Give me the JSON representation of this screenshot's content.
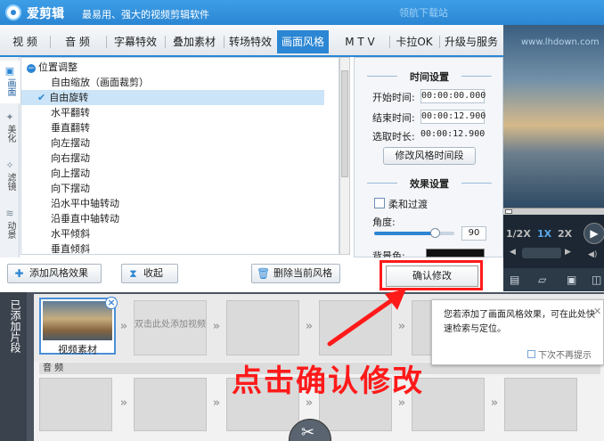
{
  "app": {
    "title": "爱剪辑",
    "slogan": "最易用、强大的视频剪辑软件",
    "watermark": "领航下载站"
  },
  "tabs": [
    {
      "label": "视 频",
      "active": false
    },
    {
      "label": "音 频",
      "active": false
    },
    {
      "label": "字幕特效",
      "active": false
    },
    {
      "label": "叠加素材",
      "active": false
    },
    {
      "label": "转场特效",
      "active": false
    },
    {
      "label": "画面风格",
      "active": true
    },
    {
      "label": "M T V",
      "active": false
    },
    {
      "label": "卡拉OK",
      "active": false
    },
    {
      "label": "升级与服务",
      "active": false
    }
  ],
  "leftbar": [
    {
      "label": "画面",
      "icon": "screen-icon",
      "active": true
    },
    {
      "label": "美化",
      "icon": "magic-wand-icon",
      "active": false
    },
    {
      "label": "滤镜",
      "icon": "filter-wand-icon",
      "active": false
    },
    {
      "label": "动景",
      "icon": "wave-icon",
      "active": false
    }
  ],
  "list": {
    "group": "位置调整",
    "items": [
      "自由缩放（画面裁剪）",
      "自由旋转",
      "水平翻转",
      "垂直翻转",
      "向左摆动",
      "向右摆动",
      "向上摆动",
      "向下摆动",
      "沿水平中轴转动",
      "沿垂直中轴转动",
      "水平倾斜",
      "垂直倾斜"
    ],
    "selected_index": 1
  },
  "settings": {
    "time_title": "时间设置",
    "start_label": "开始时间:",
    "start_value": "00:00:00.000",
    "end_label": "结束时间:",
    "end_value": "00:00:12.900",
    "duration_label": "选取时长:",
    "duration_value": "00:00:12.900",
    "modify_time_btn": "修改风格时间段",
    "effect_title": "效果设置",
    "smooth_label": "柔和过渡",
    "angle_label": "角度:",
    "angle_value": "90",
    "angle_fraction": 0.75,
    "bg_label": "背景色:"
  },
  "buttons": {
    "add_effect": "添加风格效果",
    "collapse": "收起",
    "delete_style": "删除当前风格",
    "confirm": "确认修改"
  },
  "preview": {
    "watermark": "www.lhdown.com",
    "speeds": [
      "1/2X",
      "1X",
      "2X"
    ],
    "active_speed": "1X"
  },
  "timeline": {
    "add_label": "已添加片段",
    "clip_label": "视频素材",
    "hint": "双击此处添加视频",
    "audio_label": "音 频"
  },
  "popup": {
    "text": "您若添加了画面风格效果，可在此处快速检索与定位。",
    "dont_show": "下次不再提示"
  },
  "annotation": {
    "text": "点击确认修改",
    "color": "#ff1a1a"
  },
  "colors": {
    "accent": "#2b86d3",
    "highlight": "#ff1a1a"
  }
}
